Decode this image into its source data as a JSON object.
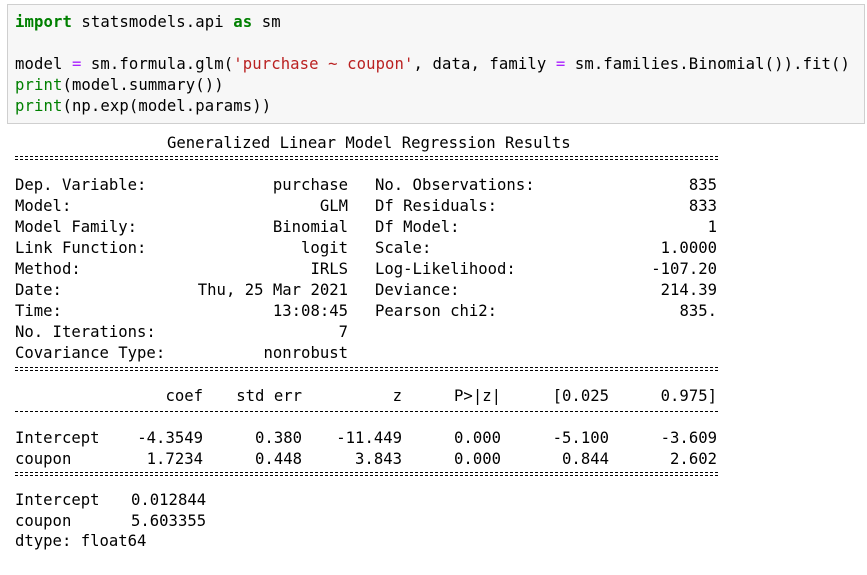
{
  "code_cell": {
    "lines": [
      [
        {
          "t": "import",
          "c": "kw"
        },
        {
          "t": " statsmodels.api ",
          "c": "plain"
        },
        {
          "t": "as",
          "c": "kw"
        },
        {
          "t": " sm",
          "c": "plain"
        }
      ],
      [],
      [
        {
          "t": "model ",
          "c": "plain"
        },
        {
          "t": "=",
          "c": "op"
        },
        {
          "t": " sm.formula.glm(",
          "c": "plain"
        },
        {
          "t": "'purchase ~ coupon'",
          "c": "str"
        },
        {
          "t": ", data, family ",
          "c": "plain"
        },
        {
          "t": "=",
          "c": "op"
        },
        {
          "t": " sm.families.Binomial()).fit()",
          "c": "plain"
        }
      ],
      [
        {
          "t": "print",
          "c": "builtin"
        },
        {
          "t": "(model.summary())",
          "c": "plain"
        }
      ],
      [
        {
          "t": "print",
          "c": "builtin"
        },
        {
          "t": "(np.exp(model.params))",
          "c": "plain"
        }
      ]
    ]
  },
  "output": {
    "title": "Generalized Linear Model Regression Results",
    "info_left": [
      {
        "label": "Dep. Variable:",
        "value": "purchase"
      },
      {
        "label": "Model:",
        "value": "GLM"
      },
      {
        "label": "Model Family:",
        "value": "Binomial"
      },
      {
        "label": "Link Function:",
        "value": "logit"
      },
      {
        "label": "Method:",
        "value": "IRLS"
      },
      {
        "label": "Date:",
        "value": "Thu, 25 Mar 2021"
      },
      {
        "label": "Time:",
        "value": "13:08:45"
      },
      {
        "label": "No. Iterations:",
        "value": "7"
      },
      {
        "label": "Covariance Type:",
        "value": "nonrobust"
      }
    ],
    "info_right": [
      {
        "label": "No. Observations:",
        "value": "835"
      },
      {
        "label": "Df Residuals:",
        "value": "833"
      },
      {
        "label": "Df Model:",
        "value": "1"
      },
      {
        "label": "Scale:",
        "value": "1.0000"
      },
      {
        "label": "Log-Likelihood:",
        "value": "-107.20"
      },
      {
        "label": "Deviance:",
        "value": "214.39"
      },
      {
        "label": "Pearson chi2:",
        "value": "835."
      }
    ],
    "coef_headers": [
      "coef",
      "std err",
      "z",
      "P>|z|",
      "[0.025",
      "0.975]"
    ],
    "coef_rows": [
      {
        "name": "Intercept",
        "cells": [
          "-4.3549",
          "0.380",
          "-11.449",
          "0.000",
          "-5.100",
          "-3.609"
        ]
      },
      {
        "name": "coupon",
        "cells": [
          "1.7234",
          "0.448",
          "3.843",
          "0.000",
          "0.844",
          "2.602"
        ]
      }
    ],
    "params": [
      {
        "name": "Intercept",
        "value": "0.012844"
      },
      {
        "name": "coupon",
        "value": "5.603355"
      }
    ],
    "dtype_line": "dtype: float64"
  }
}
